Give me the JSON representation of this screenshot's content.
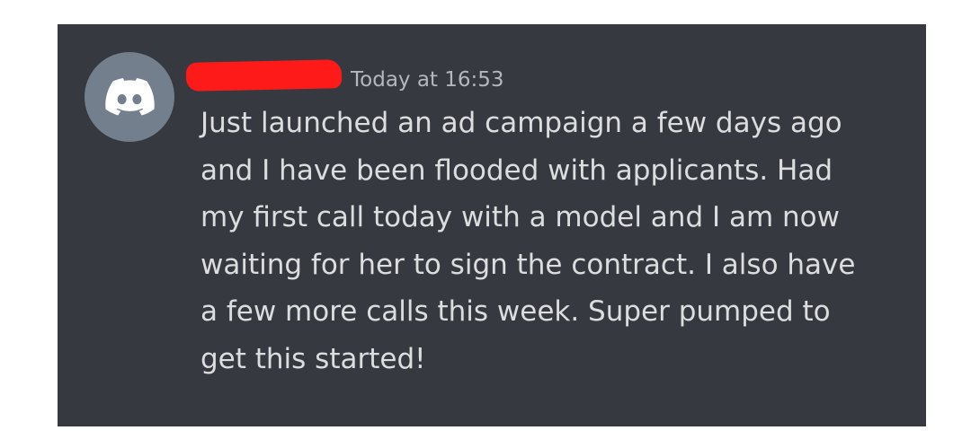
{
  "message": {
    "username_redacted": true,
    "timestamp": "Today at 16:53",
    "lines": [
      "Just launched an ad campaign a few days ago",
      "and I have been flooded with applicants. Had",
      "my first call today with a model and I am now",
      "waiting for her to sign the contract. I also have",
      "a few more calls this week. Super pumped to",
      "get this started!"
    ]
  },
  "avatar": {
    "icon": "discord-logo-icon",
    "background": "#747f8d"
  },
  "colors": {
    "card_background": "#36393f",
    "message_text": "#dcddde",
    "timestamp_text": "#b4b7bc",
    "redaction": "#ff1a1a"
  }
}
